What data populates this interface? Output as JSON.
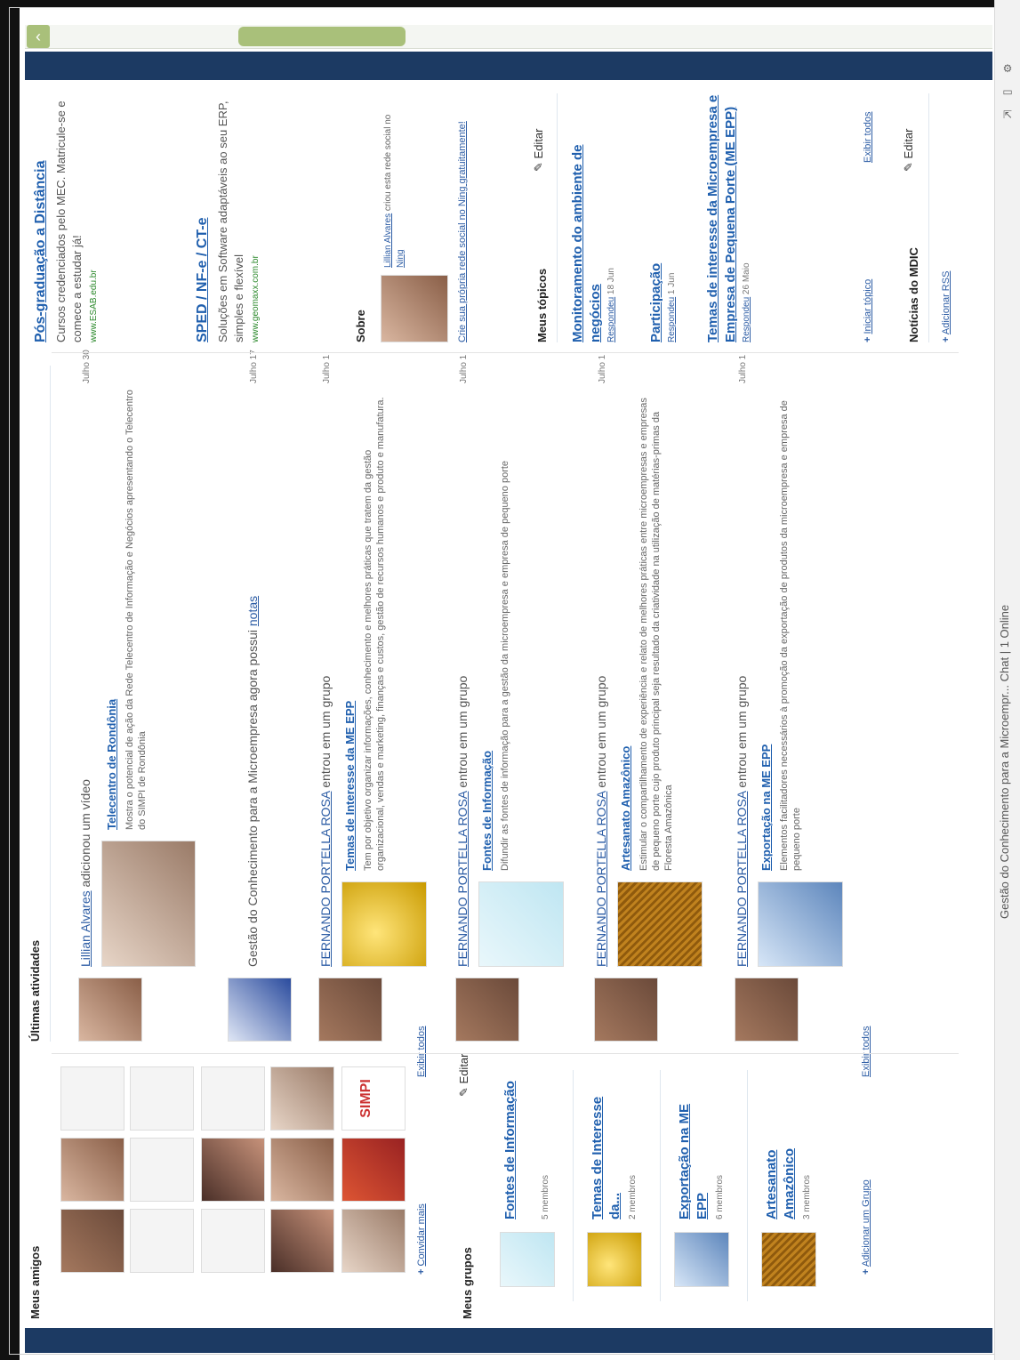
{
  "status_bar": {
    "text": "Gestão do Conhecimento para a Microempr... Chat | 1 Online"
  },
  "friends": {
    "title": "Meus amigos",
    "logo_text": "SIMPI",
    "invite_label": "Convidar mais",
    "view_all": "Exibir todos"
  },
  "groups": {
    "title": "Meus grupos",
    "edit_label": "Editar",
    "items": [
      {
        "name": "Fontes de Informação",
        "members": "5 membros"
      },
      {
        "name": "Temas de Interesse da...",
        "members": "2 membros"
      },
      {
        "name": "Exportação na ME EPP",
        "members": "6 membros"
      },
      {
        "name": "Artesanato Amazônico",
        "members": "3 membros"
      }
    ],
    "add_label": "Adicionar um Grupo",
    "view_all": "Exibir todos"
  },
  "activities": {
    "title": "Últimas atividades",
    "items": [
      {
        "actor": "Lillian Alvares",
        "action": "adicionou um vídeo",
        "date": "Julho 30",
        "item_title": "Telecentro de Rondônia",
        "description": "Mostra o potencial de ação da Rede Telecentro de Informação e Negócios apresentando o Telecentro do SIMPI de Rondônia"
      },
      {
        "text": "Gestão do Conhecimento para a Microempresa agora possui",
        "link": "notas",
        "date": "Julho 17"
      },
      {
        "actor": "FERNANDO PORTELLA ROSA",
        "action": "entrou em um grupo",
        "date": "Julho 1",
        "item_title": "Temas de Interesse da ME EPP",
        "description": "Tem por objetivo organizar informações, conhecimento e melhores práticas que tratem da gestão organizacional, vendas e marketing, finanças e custos, gestão de recursos humanos e produto e manufatura."
      },
      {
        "actor": "FERNANDO PORTELLA ROSA",
        "action": "entrou em um grupo",
        "date": "Julho 1",
        "item_title": "Fontes de Informação",
        "description": "Difundir as fontes de informação para a gestão da microempresa e empresa de pequeno porte"
      },
      {
        "actor": "FERNANDO PORTELLA ROSA",
        "action": "entrou em um grupo",
        "date": "Julho 1",
        "item_title": "Artesanato Amazônico",
        "description": "Estimular o compartilhamento de experiência e relato de melhores práticas entre microempresas e empresas de pequeno porte cujo produto principal seja resultado da criatividade na utilização de matérias-primas da Floresta Amazônica"
      },
      {
        "actor": "FERNANDO PORTELLA ROSA",
        "action": "entrou em um grupo",
        "date": "Julho 1",
        "item_title": "Exportação na ME EPP",
        "description": "Elementos facilitadores necessários à promoção da exportação de produtos da microempresa e empresa de pequeno porte"
      }
    ]
  },
  "ads": [
    {
      "title": "Pós-graduação a Distância",
      "text": "Cursos credenciados pelo MEC. Matricule-se e comece a estudar já!",
      "url": "www.ESAB.edu.br"
    },
    {
      "title": "SPED / NF-e / CT-e",
      "text": "Soluções em Software adaptáveis ao seu ERP, simples e flexível",
      "url": "www.geomaxx.com.br"
    }
  ],
  "about": {
    "title": "Sobre",
    "owner": "Lillian Alvares",
    "text": "criou esta rede social no",
    "network": "Ning",
    "create_link": "Crie sua própria rede social no Ning gratuitamente!"
  },
  "topics": {
    "title": "Meus tópicos",
    "edit_label": "Editar",
    "items": [
      {
        "title": "Monitoramento do ambiente de negócios",
        "reply_label": "Respondeu",
        "date": "18 Jun"
      },
      {
        "title": "Participação",
        "reply_label": "Respondeu",
        "date": "1 Jun"
      },
      {
        "title": "Temas de interesse da Microempresa e Empresa de Pequena Porte (ME EPP)",
        "reply_label": "Respondeu",
        "date": "26 Maio"
      }
    ],
    "start_label": "Iniciar tópico",
    "view_all": "Exibir todos"
  },
  "news": {
    "title": "Notícias do MDIC",
    "edit_label": "Editar",
    "add_rss": "Adicionar RSS"
  }
}
